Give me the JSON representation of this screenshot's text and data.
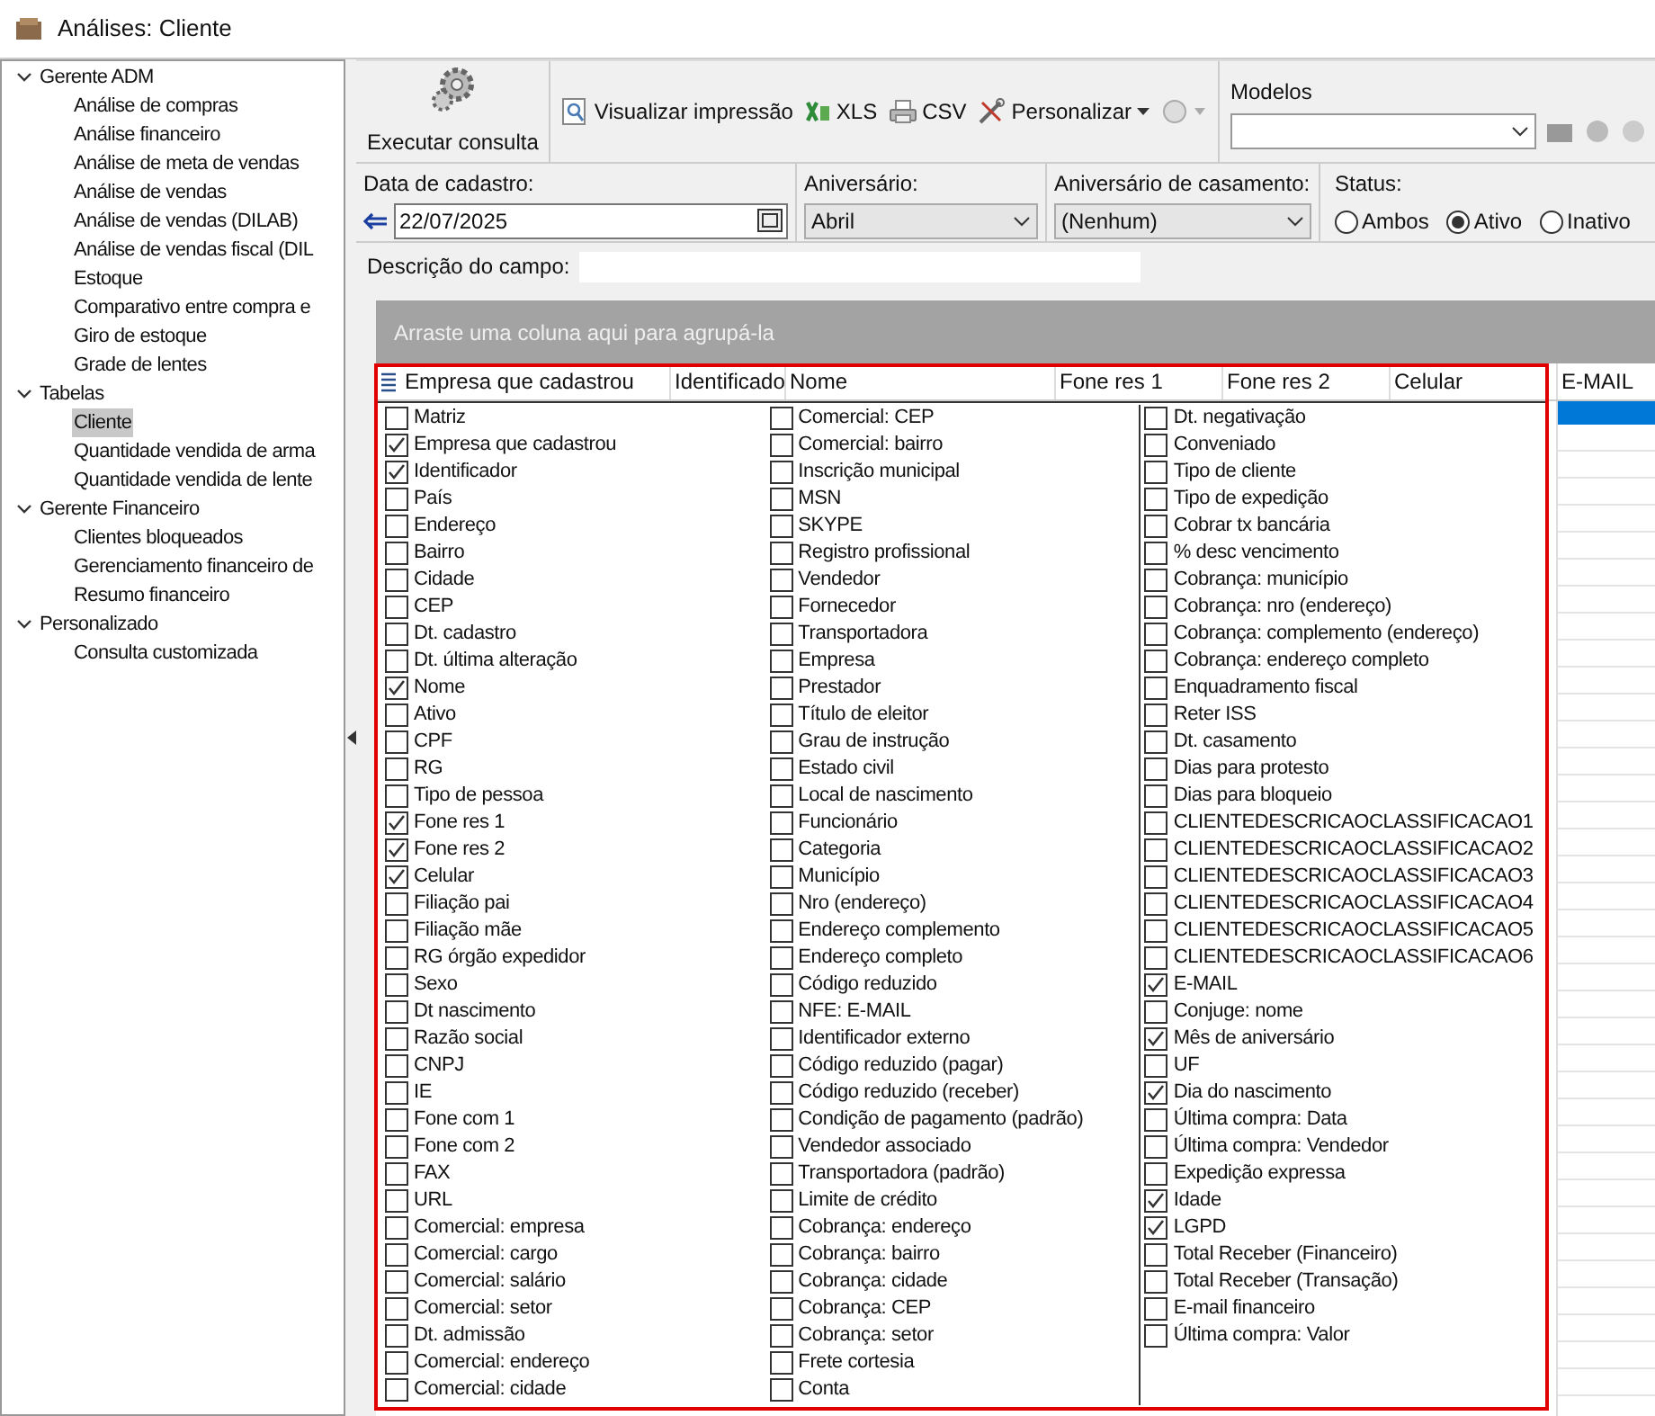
{
  "window": {
    "title": "Análises: Cliente"
  },
  "tree": [
    {
      "label": "Gerente ADM",
      "expanded": true,
      "children": [
        {
          "label": "Análise de compras",
          "selected": false
        },
        {
          "label": "Análise financeiro",
          "selected": false
        },
        {
          "label": "Análise de meta de vendas",
          "selected": false
        },
        {
          "label": "Análise de vendas",
          "selected": false
        },
        {
          "label": "Análise de vendas (DILAB)",
          "selected": false
        },
        {
          "label": "Análise de vendas fiscal (DIL",
          "selected": false
        },
        {
          "label": "Estoque",
          "selected": false
        },
        {
          "label": "Comparativo entre compra e",
          "selected": false
        },
        {
          "label": "Giro de estoque",
          "selected": false
        },
        {
          "label": "Grade de lentes",
          "selected": false
        }
      ]
    },
    {
      "label": "Tabelas",
      "expanded": true,
      "children": [
        {
          "label": "Cliente",
          "selected": true
        },
        {
          "label": "Quantidade vendida de arma",
          "selected": false
        },
        {
          "label": "Quantidade vendida de lente",
          "selected": false
        }
      ]
    },
    {
      "label": "Gerente Financeiro",
      "expanded": true,
      "children": [
        {
          "label": "Clientes bloqueados",
          "selected": false
        },
        {
          "label": "Gerenciamento financeiro de",
          "selected": false
        },
        {
          "label": "Resumo financeiro",
          "selected": false
        }
      ]
    },
    {
      "label": "Personalizado",
      "expanded": true,
      "children": [
        {
          "label": "Consulta customizada",
          "selected": false
        }
      ]
    }
  ],
  "toolbar": {
    "execute": "Executar consulta",
    "buttons": [
      {
        "label": "Visualizar impressão",
        "kind": "preview"
      },
      {
        "label": "XLS",
        "kind": "xls"
      },
      {
        "label": "CSV",
        "kind": "csv"
      },
      {
        "label": "Personalizar",
        "kind": "customize"
      }
    ],
    "models_label": "Modelos"
  },
  "filters": {
    "date": {
      "label": "Data de cadastro:",
      "value": "22/07/2025"
    },
    "birthday": {
      "label": "Aniversário:",
      "value": "Abril"
    },
    "wedding": {
      "label": "Aniversário de casamento:",
      "value": "(Nenhum)"
    },
    "status": {
      "label": "Status:",
      "options": [
        {
          "label": "Ambos",
          "selected": false
        },
        {
          "label": "Ativo",
          "selected": true
        },
        {
          "label": "Inativo",
          "selected": false
        }
      ]
    }
  },
  "description": {
    "label": "Descrição do campo:"
  },
  "grid": {
    "group_hint": "Arraste uma coluna aqui para agrupá-la",
    "columns": [
      "Empresa que cadastrou",
      "Identificado",
      "Nome",
      "Fone res 1",
      "Fone res 2",
      "Celular",
      "E-MAIL"
    ],
    "picker": [
      [
        {
          "label": "Matriz",
          "checked": false
        },
        {
          "label": "Empresa que cadastrou",
          "checked": true
        },
        {
          "label": "Identificador",
          "checked": true
        },
        {
          "label": "País",
          "checked": false
        },
        {
          "label": "Endereço",
          "checked": false
        },
        {
          "label": "Bairro",
          "checked": false
        },
        {
          "label": "Cidade",
          "checked": false
        },
        {
          "label": "CEP",
          "checked": false
        },
        {
          "label": "Dt. cadastro",
          "checked": false
        },
        {
          "label": "Dt. última alteração",
          "checked": false
        },
        {
          "label": "Nome",
          "checked": true
        },
        {
          "label": "Ativo",
          "checked": false
        },
        {
          "label": "CPF",
          "checked": false
        },
        {
          "label": "RG",
          "checked": false
        },
        {
          "label": "Tipo de pessoa",
          "checked": false
        },
        {
          "label": "Fone res 1",
          "checked": true
        },
        {
          "label": "Fone res 2",
          "checked": true
        },
        {
          "label": "Celular",
          "checked": true
        },
        {
          "label": "Filiação pai",
          "checked": false
        },
        {
          "label": "Filiação mãe",
          "checked": false
        },
        {
          "label": "RG órgão expedidor",
          "checked": false
        },
        {
          "label": "Sexo",
          "checked": false
        },
        {
          "label": "Dt nascimento",
          "checked": false
        },
        {
          "label": "Razão social",
          "checked": false
        },
        {
          "label": "CNPJ",
          "checked": false
        },
        {
          "label": "IE",
          "checked": false
        },
        {
          "label": "Fone com 1",
          "checked": false
        },
        {
          "label": "Fone com 2",
          "checked": false
        },
        {
          "label": "FAX",
          "checked": false
        },
        {
          "label": "URL",
          "checked": false
        },
        {
          "label": "Comercial: empresa",
          "checked": false
        },
        {
          "label": "Comercial: cargo",
          "checked": false
        },
        {
          "label": "Comercial: salário",
          "checked": false
        },
        {
          "label": "Comercial: setor",
          "checked": false
        },
        {
          "label": "Dt. admissão",
          "checked": false
        },
        {
          "label": "Comercial: endereço",
          "checked": false
        },
        {
          "label": "Comercial: cidade",
          "checked": false
        }
      ],
      [
        {
          "label": "Comercial: CEP",
          "checked": false
        },
        {
          "label": "Comercial: bairro",
          "checked": false
        },
        {
          "label": "Inscrição municipal",
          "checked": false
        },
        {
          "label": "MSN",
          "checked": false
        },
        {
          "label": "SKYPE",
          "checked": false
        },
        {
          "label": "Registro profissional",
          "checked": false
        },
        {
          "label": "Vendedor",
          "checked": false
        },
        {
          "label": "Fornecedor",
          "checked": false
        },
        {
          "label": "Transportadora",
          "checked": false
        },
        {
          "label": "Empresa",
          "checked": false
        },
        {
          "label": "Prestador",
          "checked": false
        },
        {
          "label": "Título de eleitor",
          "checked": false
        },
        {
          "label": "Grau de instrução",
          "checked": false
        },
        {
          "label": "Estado civil",
          "checked": false
        },
        {
          "label": "Local de nascimento",
          "checked": false
        },
        {
          "label": "Funcionário",
          "checked": false
        },
        {
          "label": "Categoria",
          "checked": false
        },
        {
          "label": "Município",
          "checked": false
        },
        {
          "label": "Nro (endereço)",
          "checked": false
        },
        {
          "label": "Endereço complemento",
          "checked": false
        },
        {
          "label": "Endereço completo",
          "checked": false
        },
        {
          "label": "Código reduzido",
          "checked": false
        },
        {
          "label": "NFE: E-MAIL",
          "checked": false
        },
        {
          "label": "Identificador externo",
          "checked": false
        },
        {
          "label": "Código reduzido (pagar)",
          "checked": false
        },
        {
          "label": "Código reduzido (receber)",
          "checked": false
        },
        {
          "label": "Condição de pagamento (padrão)",
          "checked": false
        },
        {
          "label": "Vendedor associado",
          "checked": false
        },
        {
          "label": "Transportadora (padrão)",
          "checked": false
        },
        {
          "label": "Limite de crédito",
          "checked": false
        },
        {
          "label": "Cobrança: endereço",
          "checked": false
        },
        {
          "label": "Cobrança: bairro",
          "checked": false
        },
        {
          "label": "Cobrança: cidade",
          "checked": false
        },
        {
          "label": "Cobrança: CEP",
          "checked": false
        },
        {
          "label": "Cobrança: setor",
          "checked": false
        },
        {
          "label": "Frete cortesia",
          "checked": false
        },
        {
          "label": "Conta",
          "checked": false
        }
      ],
      [
        {
          "label": "Dt. negativação",
          "checked": false
        },
        {
          "label": "Conveniado",
          "checked": false
        },
        {
          "label": "Tipo de cliente",
          "checked": false
        },
        {
          "label": "Tipo de expedição",
          "checked": false
        },
        {
          "label": "Cobrar tx bancária",
          "checked": false
        },
        {
          "label": "% desc vencimento",
          "checked": false
        },
        {
          "label": "Cobrança: município",
          "checked": false
        },
        {
          "label": "Cobrança: nro (endereço)",
          "checked": false
        },
        {
          "label": "Cobrança: complemento (endereço)",
          "checked": false
        },
        {
          "label": "Cobrança: endereço completo",
          "checked": false
        },
        {
          "label": "Enquadramento fiscal",
          "checked": false
        },
        {
          "label": "Reter ISS",
          "checked": false
        },
        {
          "label": "Dt. casamento",
          "checked": false
        },
        {
          "label": "Dias para protesto",
          "checked": false
        },
        {
          "label": "Dias para bloqueio",
          "checked": false
        },
        {
          "label": "CLIENTEDESCRICAOCLASSIFICACAO1",
          "checked": false
        },
        {
          "label": "CLIENTEDESCRICAOCLASSIFICACAO2",
          "checked": false
        },
        {
          "label": "CLIENTEDESCRICAOCLASSIFICACAO3",
          "checked": false
        },
        {
          "label": "CLIENTEDESCRICAOCLASSIFICACAO4",
          "checked": false
        },
        {
          "label": "CLIENTEDESCRICAOCLASSIFICACAO5",
          "checked": false
        },
        {
          "label": "CLIENTEDESCRICAOCLASSIFICACAO6",
          "checked": false
        },
        {
          "label": "E-MAIL",
          "checked": true
        },
        {
          "label": "Conjuge: nome",
          "checked": false
        },
        {
          "label": "Mês de aniversário",
          "checked": true
        },
        {
          "label": "UF",
          "checked": false
        },
        {
          "label": "Dia do nascimento",
          "checked": true
        },
        {
          "label": "Última compra: Data",
          "checked": false
        },
        {
          "label": "Última compra: Vendedor",
          "checked": false
        },
        {
          "label": "Expedição expressa",
          "checked": false
        },
        {
          "label": "Idade",
          "checked": true
        },
        {
          "label": "LGPD",
          "checked": true
        },
        {
          "label": "Total Receber (Financeiro)",
          "checked": false
        },
        {
          "label": "Total Receber (Transação)",
          "checked": false
        },
        {
          "label": "E-mail financeiro",
          "checked": false
        },
        {
          "label": "Última compra: Valor",
          "checked": false
        }
      ]
    ]
  }
}
